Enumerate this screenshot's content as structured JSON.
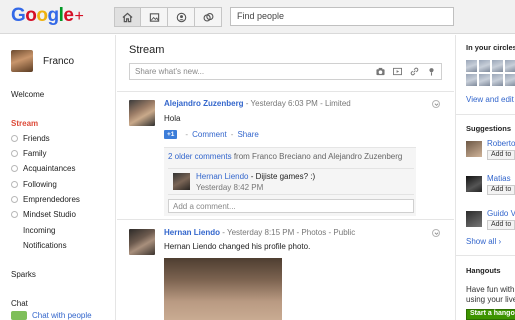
{
  "header": {
    "logo_letters": [
      "G",
      "o",
      "o",
      "g",
      "l",
      "e"
    ],
    "logo_plus": "+",
    "search_placeholder": "Find people"
  },
  "colors": {
    "brand_red": "#dd4b39",
    "link_blue": "#3366cc",
    "hangout_green": "#3d9400"
  },
  "sidebar": {
    "profile_name": "Franco",
    "welcome": "Welcome",
    "stream": "Stream",
    "circles": [
      "Friends",
      "Family",
      "Acquaintances",
      "Following",
      "Emprendedores",
      "Mindset Studio"
    ],
    "incoming": "Incoming",
    "notifications": "Notifications",
    "sparks": "Sparks",
    "chat_header": "Chat",
    "chat_link": "Chat with people"
  },
  "main": {
    "title": "Stream",
    "share_placeholder": "Share what's new...",
    "share_icons": [
      "camera-icon",
      "video-icon",
      "link-icon",
      "location-icon"
    ],
    "posts": [
      {
        "author": "Alejandro Zuzenberg",
        "meta": "-  Yesterday 6:03 PM  -  Limited",
        "text": "Hola",
        "plusone": "+1",
        "comment_label": "Comment",
        "share_label": "Share",
        "older_comments_link": "2 older comments",
        "older_comments_rest": "from Franco Breciano and Alejandro Zuzenberg",
        "comment": {
          "author": "Hernan Liendo",
          "text": "- Dijiste games? :)",
          "time": "Yesterday 8:42 PM"
        },
        "add_comment_placeholder": "Add a comment..."
      },
      {
        "author": "Hernan Liendo",
        "meta": "-  Yesterday 8:15 PM  -  Photos  -  Public",
        "text": "Hernan Liendo changed his profile photo."
      }
    ]
  },
  "right": {
    "circles_header": "In your circles (",
    "view_edit": "View and edit c",
    "suggestions_header": "Suggestions",
    "suggestions": [
      {
        "name": "Roberto",
        "add": "Add to"
      },
      {
        "name": "Matias",
        "add": "Add to"
      },
      {
        "name": "Guido V",
        "add": "Add to"
      }
    ],
    "show_all": "Show all ›",
    "hangouts_header": "Hangouts",
    "hangouts_line1": "Have fun with",
    "hangouts_line2": "using your live",
    "hangout_button": "Start a hangou"
  }
}
